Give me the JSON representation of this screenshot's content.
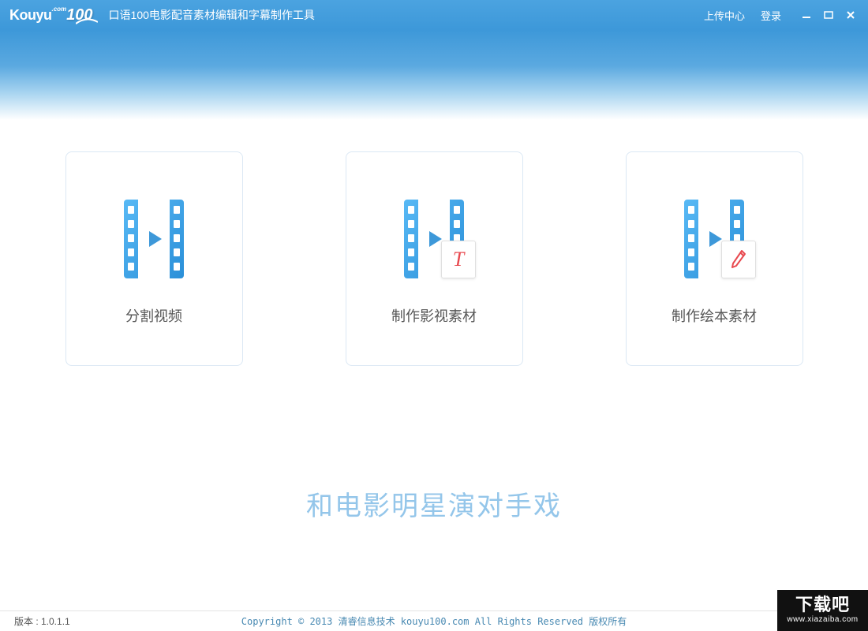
{
  "titlebar": {
    "logo_kouyu": "Kouyu",
    "logo_100": "100",
    "logo_com": ".com",
    "app_title": "口语100电影配音素材编辑和字幕制作工具",
    "upload_link": "上传中心",
    "login_link": "登录"
  },
  "cards": [
    {
      "label": "分割视频",
      "name": "split-video-card",
      "badge": null
    },
    {
      "label": "制作影视素材",
      "name": "make-video-material-card",
      "badge": "text"
    },
    {
      "label": "制作绘本素材",
      "name": "make-picturebook-material-card",
      "badge": "pencil"
    }
  ],
  "slogan": "和电影明星演对手戏",
  "footer": {
    "version_label": "版本 : 1.0.1.1",
    "copyright": "Copyright © 2013 清睿信息技术 kouyu100.com All Rights Reserved 版权所有"
  },
  "watermark": {
    "main": "下载吧",
    "sub": "www.xiazaiba.com"
  }
}
